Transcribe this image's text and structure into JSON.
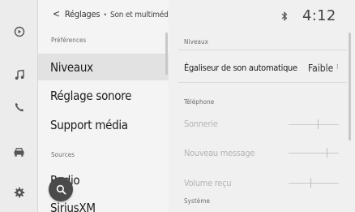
{
  "header": {
    "back_glyph": "<",
    "breadcrumb_main": "Réglages",
    "breadcrumb_sep": "•",
    "breadcrumb_sub": "Son et multimédia",
    "clock": "4:12",
    "bluetooth_icon": "bluetooth-icon"
  },
  "rail": {
    "items": [
      {
        "icon": "media-source-icon"
      },
      {
        "icon": "music-note-icon"
      },
      {
        "icon": "phone-icon"
      },
      {
        "icon": "car-icon"
      },
      {
        "icon": "settings-gear-icon"
      }
    ]
  },
  "left": {
    "preferences_header": "Préférences",
    "items": [
      "Niveaux",
      "Réglage sonore",
      "Support média"
    ],
    "sources_header": "Sources",
    "sources": [
      "Radio",
      "SiriusXM"
    ]
  },
  "right": {
    "levels_header": "Niveaux",
    "auto_eq_label": "Égaliseur de son automatique",
    "auto_eq_value": "Faible",
    "kebab": "⁝",
    "phone_header": "Téléphone",
    "phone_items": [
      "Sonnerie",
      "Nouveau message",
      "Volume reçu"
    ],
    "system_header": "Système"
  },
  "fab": {
    "icon": "search-icon"
  }
}
